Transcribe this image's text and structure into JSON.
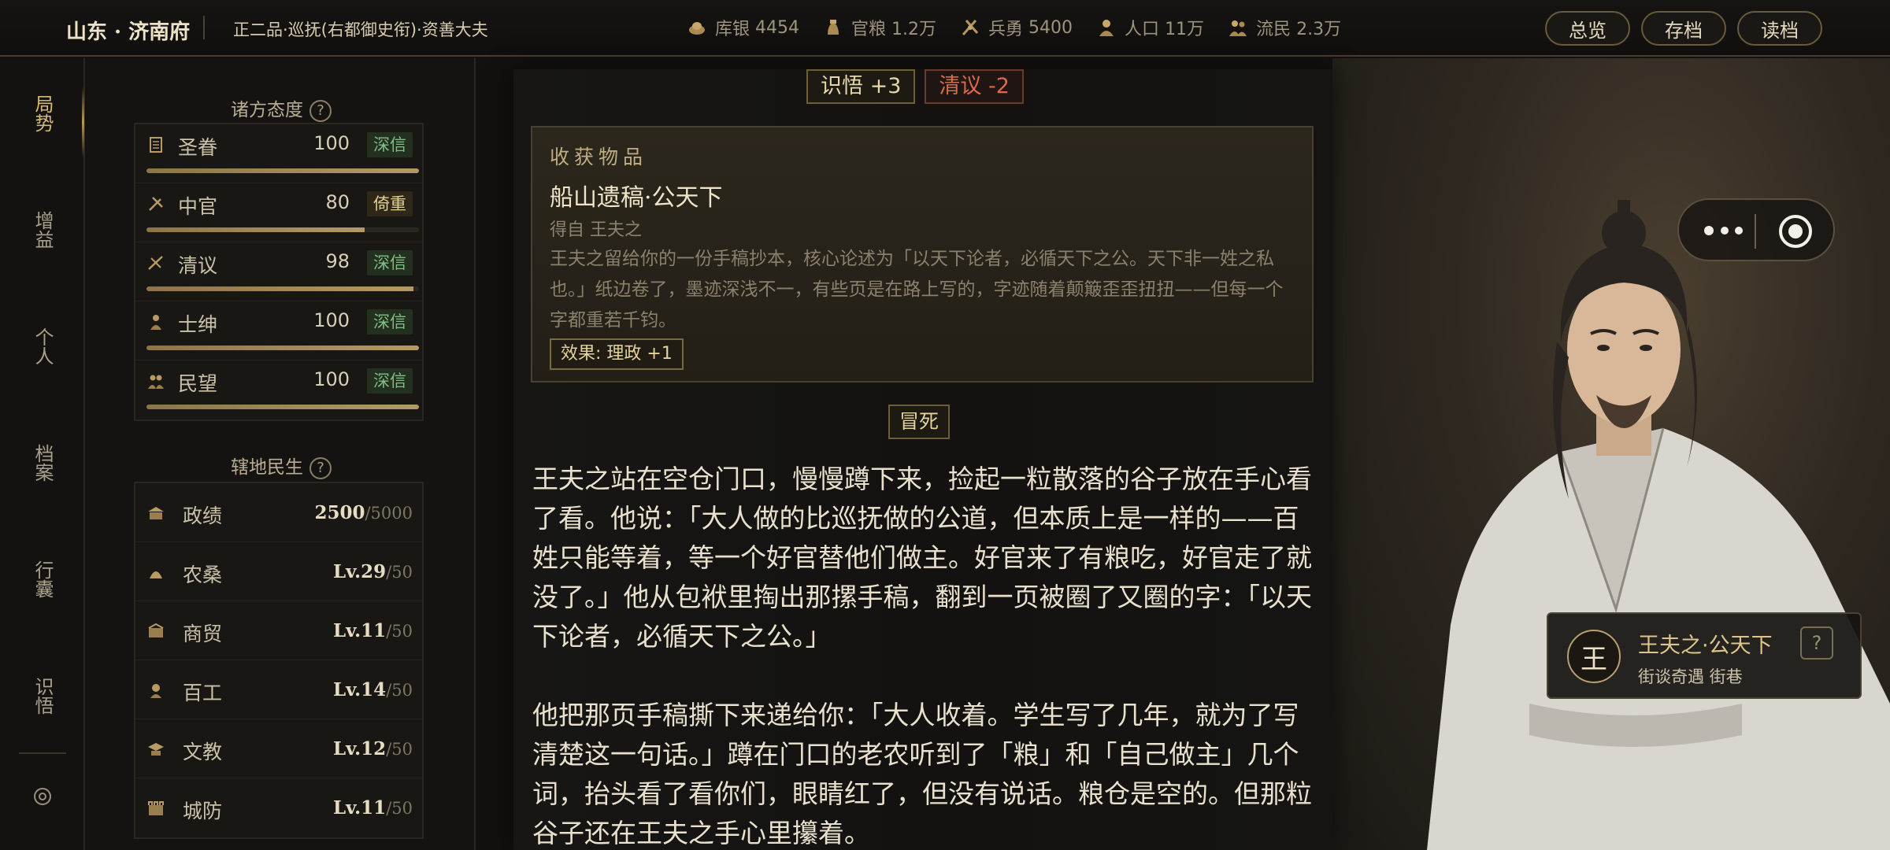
{
  "header": {
    "region": "山东 · 济南府",
    "office": "正二品·巡抚(右都御史衔)·资善大夫",
    "stats": [
      {
        "icon": "silver-icon",
        "label": "库银",
        "value": "4454"
      },
      {
        "icon": "grain-icon",
        "label": "官粮",
        "value": "1.2万"
      },
      {
        "icon": "soldier-icon",
        "label": "兵勇",
        "value": "5400"
      },
      {
        "icon": "population-icon",
        "label": "人口",
        "value": "11万"
      },
      {
        "icon": "refugee-icon",
        "label": "流民",
        "value": "2.3万"
      }
    ],
    "buttons": {
      "overview": "总览",
      "save": "存档",
      "load": "读档"
    }
  },
  "nav": {
    "items": [
      "局势",
      "增益",
      "个人",
      "档案",
      "行囊",
      "识悟"
    ],
    "active": "局势",
    "accent": "#d6b872"
  },
  "attitudes": {
    "title": "诸方态度",
    "help": "?",
    "rows": [
      {
        "icon": "emperor-icon",
        "name": "圣眷",
        "value": "100",
        "level": 1.0,
        "tag": "深信",
        "tag_style": "green"
      },
      {
        "icon": "eunuch-icon",
        "name": "中官",
        "value": "80",
        "level": 0.8,
        "tag": "倚重",
        "tag_style": "warm"
      },
      {
        "icon": "scholar-icon",
        "name": "清议",
        "value": "98",
        "level": 0.98,
        "tag": "深信",
        "tag_style": "green"
      },
      {
        "icon": "gentry-icon",
        "name": "士绅",
        "value": "100",
        "level": 1.0,
        "tag": "深信",
        "tag_style": "green"
      },
      {
        "icon": "people-icon",
        "name": "民望",
        "value": "100",
        "level": 1.0,
        "tag": "深信",
        "tag_style": "green"
      }
    ]
  },
  "development": {
    "title": "辖地民生",
    "help": "?",
    "rows": [
      {
        "icon": "government-icon",
        "name": "政绩",
        "value": "2500",
        "max": "/5000"
      },
      {
        "icon": "agriculture-icon",
        "name": "农桑",
        "value": "Lv.29",
        "max": "/50"
      },
      {
        "icon": "trade-icon",
        "name": "商贸",
        "value": "Lv.11",
        "max": "/50"
      },
      {
        "icon": "craft-icon",
        "name": "百工",
        "value": "Lv.14",
        "max": "/50"
      },
      {
        "icon": "education-icon",
        "name": "文教",
        "value": "Lv.12",
        "max": "/50"
      },
      {
        "icon": "defense-icon",
        "name": "城防",
        "value": "Lv.11",
        "max": "/50"
      }
    ]
  },
  "story": {
    "badges": [
      {
        "text": "识悟 +3",
        "style": "gold"
      },
      {
        "text": "清议 -2",
        "style": "red"
      }
    ],
    "loot": {
      "heading": "收获物品",
      "title": "船山遗稿·公天下",
      "source": "得自 王夫之",
      "description": "王夫之留给你的一份手稿抄本，核心论述为「以天下论者，必循天下之公。天下非一姓之私也。」纸边卷了，墨迹深浅不一，有些页是在路上写的，字迹随着颠簸歪歪扭扭——但每一个字都重若千钧。",
      "effect": "效果: 理政 +1"
    },
    "choice": "冒死",
    "paragraphs": [
      "王夫之站在空仓门口，慢慢蹲下来，捡起一粒散落的谷子放在手心看了看。他说：「大人做的比巡抚做的公道，但本质上是一样的——百姓只能等着，等一个好官替他们做主。好官来了有粮吃，好官走了就没了。」他从包袱里掏出那摞手稿，翻到一页被圈了又圈的字：「以天下论者，必循天下之公。」",
      "他把那页手稿撕下来递给你：「大人收着。学生写了几年，就为了写清楚这一句话。」蹲在门口的老农听到了「粮」和「自己做主」几个词，抬头看了看你们，眼睛红了，但没有说话。粮仓是空的。但那粒谷子还在王夫之手心里攥着。"
    ]
  },
  "npc": {
    "seal": "王",
    "name": "王夫之·公天下",
    "subtitle": "街谈奇遇  街巷",
    "help": "?"
  },
  "miniprogram": {
    "more_icon": "more-dots-icon",
    "close_icon": "record-target-icon"
  }
}
